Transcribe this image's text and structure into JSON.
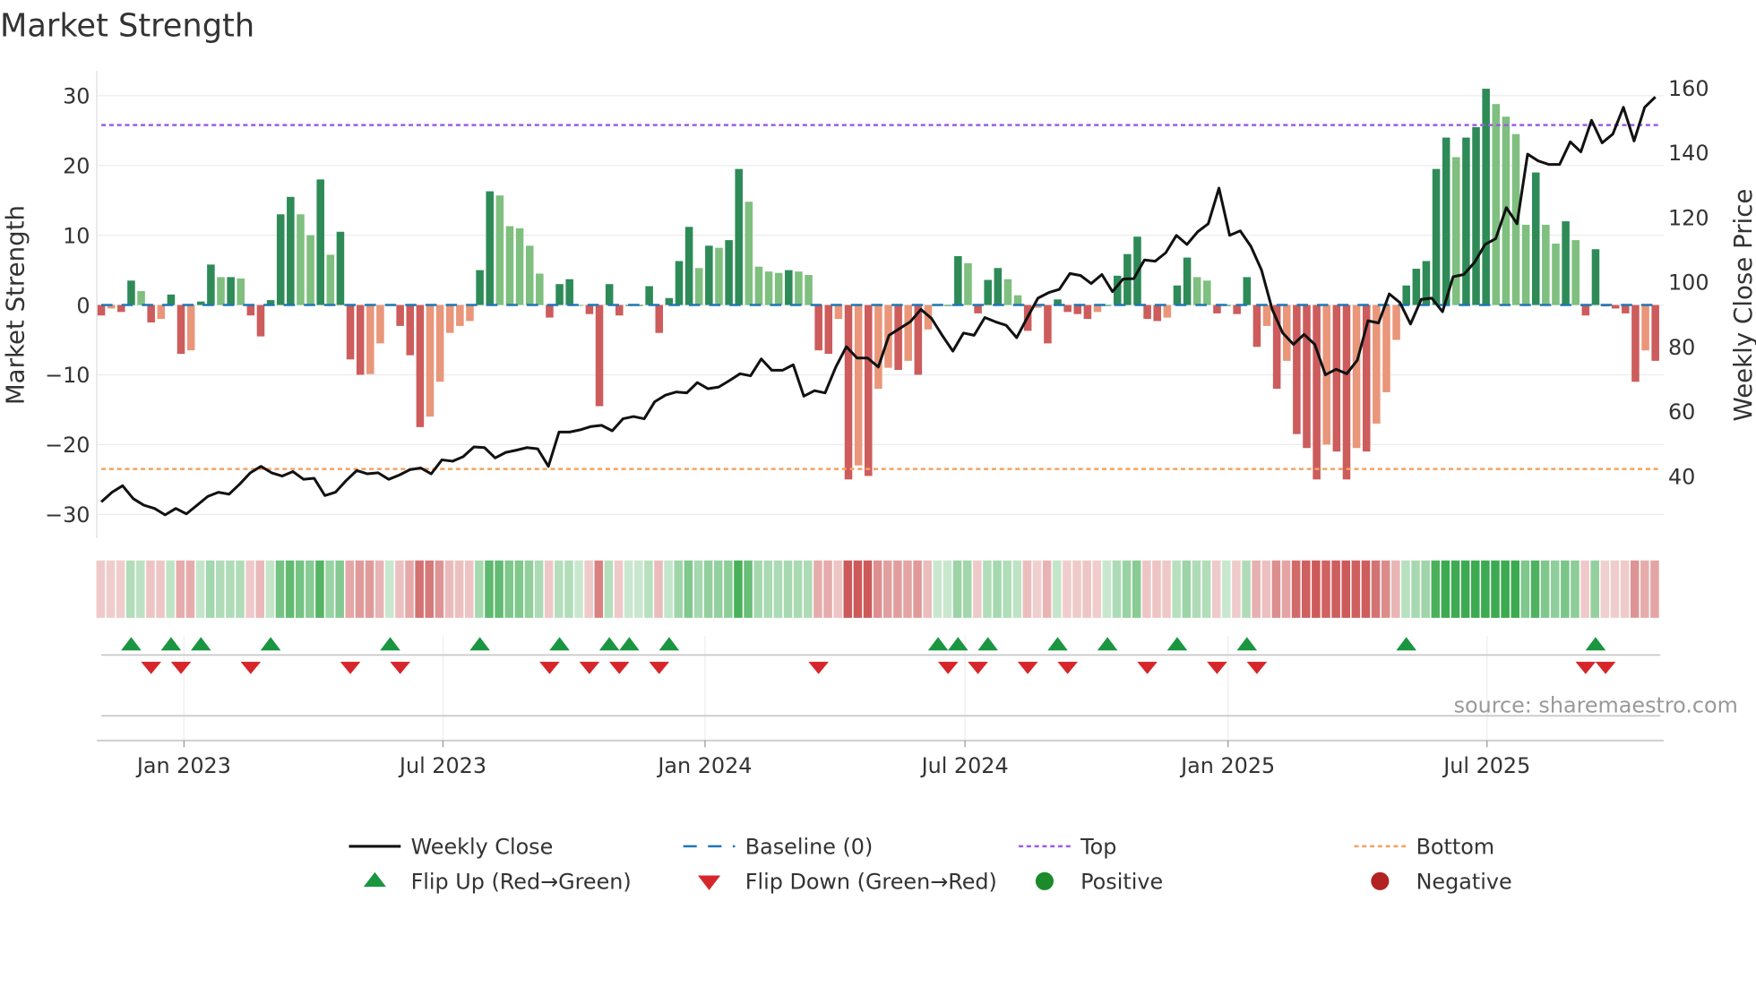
{
  "chart_data": {
    "type": "bar",
    "title": "Market Strength",
    "ylabel": "Market Strength",
    "y2label": "Weekly Close Price",
    "ylim": [
      -33,
      33
    ],
    "y2lim": [
      27.4,
      164
    ],
    "yticks": [
      30,
      20,
      10,
      0,
      -10,
      -20,
      -30
    ],
    "y2ticks": [
      160,
      140,
      120,
      100,
      80,
      60,
      40
    ],
    "xtick_labels": [
      {
        "label": "Jan 2023",
        "week": 8.3
      },
      {
        "label": "Jul 2023",
        "week": 34.3
      },
      {
        "label": "Jan 2024",
        "week": 60.6
      },
      {
        "label": "Jul 2024",
        "week": 86.7
      },
      {
        "label": "Jan 2025",
        "week": 113.1
      },
      {
        "label": "Jul 2025",
        "week": 139.1
      }
    ],
    "start_week": "2022-11-07",
    "frequency": "weekly",
    "top_level": 25.8,
    "bottom_level": -23.5,
    "strength": [
      -1.5,
      -0.5,
      -1,
      3.5,
      2,
      -2.5,
      -2,
      1.5,
      -7,
      -6.5,
      0.5,
      5.8,
      4,
      4,
      3.8,
      -1.5,
      -4.5,
      0.7,
      13,
      15.5,
      13,
      10,
      18,
      7.2,
      10.5,
      -7.8,
      -10,
      -9.9,
      -5.5,
      0,
      -3,
      -7.2,
      -17.5,
      -16,
      -11,
      -4,
      -3,
      -2.3,
      5,
      16.3,
      15.7,
      11.3,
      11,
      8.5,
      4.5,
      -1.8,
      3,
      3.7,
      0,
      -1.3,
      -14.5,
      3,
      -1.5,
      0,
      0,
      2.7,
      -4,
      1,
      6.3,
      11.2,
      5.3,
      8.5,
      8.2,
      9.3,
      19.5,
      14.8,
      5.5,
      4.8,
      4.6,
      5,
      4.8,
      4.3,
      -6.5,
      -7,
      -2,
      -25,
      -23,
      -24.5,
      -12,
      -9,
      -9.3,
      -8,
      -10,
      -3.5,
      0,
      0,
      7,
      6,
      -1.2,
      3.6,
      5.3,
      3.7,
      1.4,
      -3.7,
      -0.4,
      -5.5,
      0.8,
      -1,
      -1.3,
      -2,
      -1,
      0,
      4.2,
      7.3,
      9.8,
      -2,
      -2.3,
      -1.8,
      2.8,
      6.8,
      4,
      3.5,
      -1.2,
      0,
      -1.3,
      4,
      -6,
      -3,
      -12,
      -8,
      -18.5,
      -20.5,
      -25,
      -20,
      -21,
      -25,
      -20.5,
      -21,
      -17,
      -12.5,
      -5,
      2.8,
      5.2,
      6.3,
      19.5,
      24,
      21.2,
      24,
      25.5,
      31,
      28.8,
      27,
      24.5,
      11.5,
      19,
      11.5,
      8.8,
      12,
      9.3,
      -1.5,
      8,
      -0.2,
      -0.5,
      -1.2,
      -11,
      -6.5,
      -8
    ],
    "weekly_close": [
      32,
      35,
      37,
      33,
      31,
      30,
      28,
      30,
      28.3,
      31,
      33.7,
      35,
      34.4,
      37.5,
      41,
      43,
      41,
      40,
      41.4,
      39,
      39.3,
      34,
      35,
      38.6,
      41.7,
      40.7,
      41,
      39,
      40.3,
      42,
      42.5,
      40.7,
      45,
      44.6,
      46,
      49,
      48.8,
      45.6,
      47.3,
      48,
      48.8,
      48.4,
      43,
      53.6,
      53.6,
      54.3,
      55.3,
      55.7,
      54,
      57.7,
      58.4,
      57.7,
      63,
      65,
      66,
      65.7,
      68.9,
      67,
      67.5,
      69.5,
      71.6,
      71,
      76.2,
      72.7,
      72.7,
      74.4,
      64.7,
      66.4,
      65.7,
      73.7,
      80,
      76.5,
      76.5,
      73.7,
      83.5,
      85.6,
      87.7,
      91.5,
      88.7,
      83.5,
      78.6,
      84.2,
      83.5,
      89,
      87.7,
      86.6,
      82.8,
      89,
      95,
      96.7,
      97.7,
      102.6,
      102,
      99.5,
      102.3,
      97,
      100.9,
      101,
      106.8,
      106.4,
      109,
      114.4,
      111.6,
      115.5,
      118,
      129,
      114.4,
      115.8,
      111,
      103.7,
      91.5,
      84.2,
      80.7,
      83.8,
      80.7,
      71.3,
      73,
      71.6,
      75.8,
      88,
      87.3,
      96.3,
      93.6,
      87,
      94.6,
      95,
      90.8,
      101.6,
      102.3,
      106,
      111.6,
      113.4,
      123,
      118,
      139.5,
      137.4,
      136.3,
      136.3,
      143.3,
      140.2,
      150,
      143,
      145.7,
      154,
      143.6,
      154,
      157.2
    ],
    "flip_up_weeks": [
      3,
      7,
      10,
      17,
      29,
      38,
      46,
      51,
      53,
      57,
      84,
      86,
      89,
      96,
      101,
      108,
      115,
      131,
      150
    ],
    "flip_down_weeks": [
      5,
      8,
      15,
      25,
      30,
      45,
      49,
      52,
      56,
      72,
      85,
      88,
      93,
      97,
      105,
      112,
      116,
      149,
      151
    ],
    "colors": {
      "pos_strong": "#2e8b57",
      "pos_weak": "#7fbf7f",
      "neg_strong": "#cd5c5c",
      "neg_weak": "#e9967a",
      "close": "#111111",
      "baseline": "#1f77b4",
      "top": "#9b5de5",
      "bottom": "#f4a261",
      "flip_up": "#1a9641",
      "flip_down": "#d7262b",
      "positive": "#1a8a2a",
      "negative": "#b22222"
    },
    "legend": [
      {
        "label": "Weekly Close",
        "kind": "line"
      },
      {
        "label": "Baseline (0)",
        "kind": "dash"
      },
      {
        "label": "Top",
        "kind": "dot-top"
      },
      {
        "label": "Bottom",
        "kind": "dot-bottom"
      },
      {
        "label": "Flip Up (Red→Green)",
        "kind": "tri-up"
      },
      {
        "label": "Flip Down (Green→Red)",
        "kind": "tri-down"
      },
      {
        "label": "Positive",
        "kind": "circle-pos"
      },
      {
        "label": "Negative",
        "kind": "circle-neg"
      }
    ],
    "legend_position": "bottom",
    "source": "source: sharemaestro.com"
  }
}
